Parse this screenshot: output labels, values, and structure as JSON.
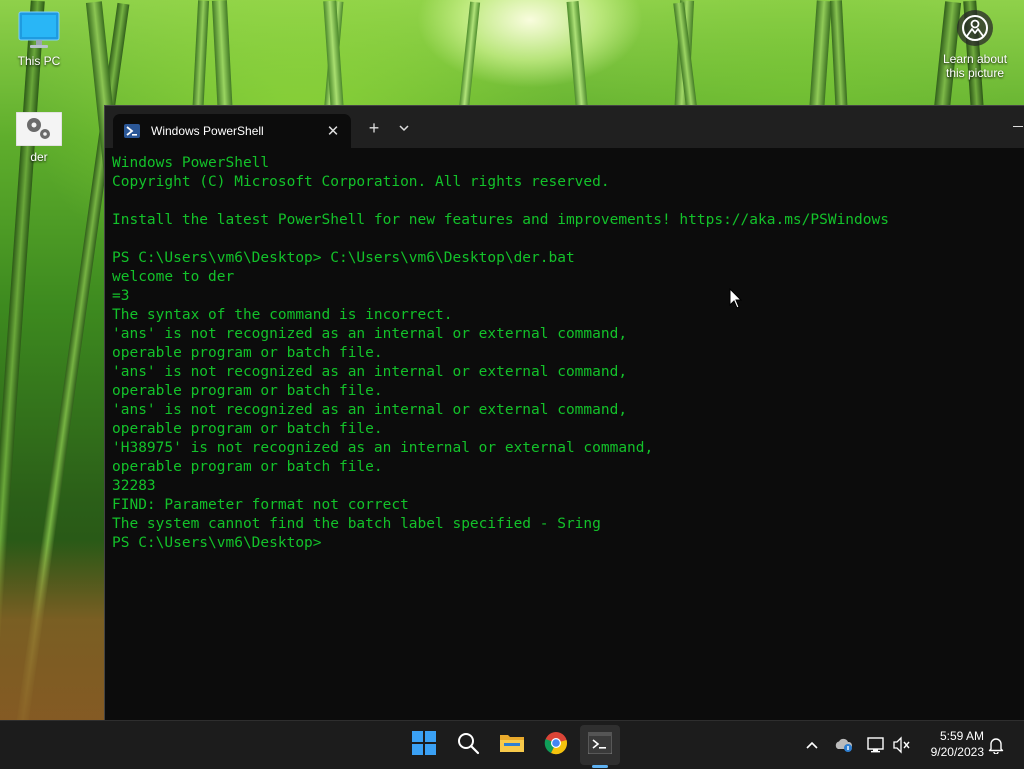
{
  "desktop": {
    "icons": [
      {
        "label": "This PC"
      },
      {
        "label": "der"
      }
    ],
    "learn_about": {
      "line1": "Learn about",
      "line2": "this picture"
    }
  },
  "window": {
    "tab_title": "Windows PowerShell",
    "tab_close_glyph": "✕",
    "new_tab_glyph": "+",
    "console_lines": [
      "Windows PowerShell",
      "Copyright (C) Microsoft Corporation. All rights reserved.",
      "",
      "Install the latest PowerShell for new features and improvements! https://aka.ms/PSWindows",
      "",
      "PS C:\\Users\\vm6\\Desktop> C:\\Users\\vm6\\Desktop\\der.bat",
      "welcome to der",
      "=3",
      "The syntax of the command is incorrect.",
      "'ans' is not recognized as an internal or external command,",
      "operable program or batch file.",
      "'ans' is not recognized as an internal or external command,",
      "operable program or batch file.",
      "'ans' is not recognized as an internal or external command,",
      "operable program or batch file.",
      "'H38975' is not recognized as an internal or external command,",
      "operable program or batch file.",
      "32283",
      "FIND: Parameter format not correct",
      "The system cannot find the batch label specified - Sring",
      "PS C:\\Users\\vm6\\Desktop>"
    ],
    "text_color": "#13c22a",
    "background": "#0c0c0c"
  },
  "taskbar": {
    "apps": [
      {
        "name": "start-icon"
      },
      {
        "name": "search-icon"
      },
      {
        "name": "file-explorer-icon"
      },
      {
        "name": "chrome-icon"
      },
      {
        "name": "terminal-icon",
        "active": true
      }
    ],
    "tray": [
      {
        "name": "chevron-up-icon"
      },
      {
        "name": "onedrive-icon"
      },
      {
        "name": "network-icon"
      },
      {
        "name": "volume-muted-icon"
      }
    ],
    "clock": {
      "time": "5:59 AM",
      "date": "9/20/2023"
    },
    "accent": "#5fb2f2"
  }
}
